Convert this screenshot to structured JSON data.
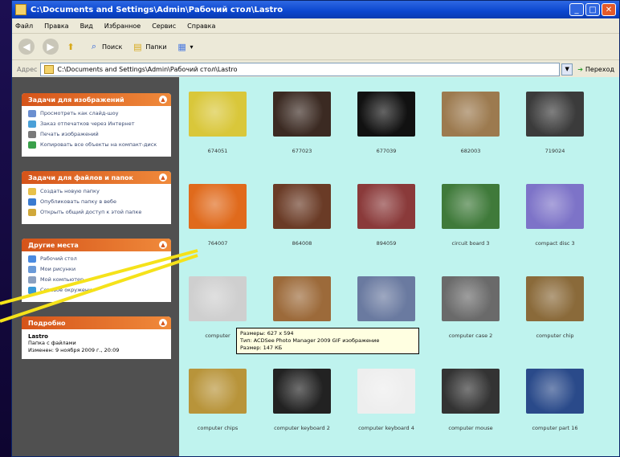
{
  "window": {
    "title": "C:\\Documents and Settings\\Admin\\Рабочий стол\\Lastro"
  },
  "menu": [
    "Файл",
    "Правка",
    "Вид",
    "Избранное",
    "Сервис",
    "Справка"
  ],
  "toolbar": {
    "search_label": "Поиск",
    "folders_label": "Папки"
  },
  "address": {
    "label": "Адрес",
    "path": "C:\\Documents and Settings\\Admin\\Рабочий стол\\Lastro",
    "go_label": "Переход"
  },
  "sidebar": {
    "panels": [
      {
        "title": "Задачи для изображений",
        "items": [
          "Просмотреть как слайд-шоу",
          "Заказ отпечатков через Интернет",
          "Печать изображений",
          "Копировать все объекты на компакт-диск"
        ]
      },
      {
        "title": "Задачи для файлов и папок",
        "items": [
          "Создать новую папку",
          "Опубликовать папку в вебе",
          "Открыть общий доступ к этой папке"
        ]
      },
      {
        "title": "Другие места",
        "items": [
          "Рабочий стол",
          "Мои рисунки",
          "Мой компьютер",
          "Сетевое окружение"
        ]
      }
    ],
    "details": {
      "title": "Подробно",
      "name": "Lastro",
      "type": "Папка с файлами",
      "modified": "Изменен: 9 ноября 2009 г., 20:09"
    }
  },
  "files": [
    {
      "name": "674051",
      "color": "#d9c73a"
    },
    {
      "name": "677023",
      "color": "#3b2a22"
    },
    {
      "name": "677039",
      "color": "#111111"
    },
    {
      "name": "682003",
      "color": "#9c7a4f"
    },
    {
      "name": "719024",
      "color": "#3b3b3b"
    },
    {
      "name": "764007",
      "color": "#e06a1c"
    },
    {
      "name": "864008",
      "color": "#6a3b26"
    },
    {
      "name": "894059",
      "color": "#8a3a3a"
    },
    {
      "name": "circuit board 3",
      "color": "#3f7a3a"
    },
    {
      "name": "compact disc 3",
      "color": "#7d73c8"
    },
    {
      "name": "computer",
      "color": "#cfcfcf"
    },
    {
      "name": "",
      "color": "#9c6a3a"
    },
    {
      "name": "",
      "color": "#6a7aa0"
    },
    {
      "name": "computer case 2",
      "color": "#6a6a6a"
    },
    {
      "name": "computer chip",
      "color": "#8a6a3a"
    },
    {
      "name": "computer chips",
      "color": "#b8943a"
    },
    {
      "name": "computer keyboard 2",
      "color": "#222222"
    },
    {
      "name": "computer keyboard 4",
      "color": "#eeeeee"
    },
    {
      "name": "computer mouse",
      "color": "#333333"
    },
    {
      "name": "computer part 16",
      "color": "#2a4a8a"
    }
  ],
  "tooltip": {
    "line1": "Размеры: 627 x 594",
    "line2": "Тип: ACDSee Photo Manager 2009 GIF изображение",
    "line3": "Размер: 147 КБ"
  }
}
